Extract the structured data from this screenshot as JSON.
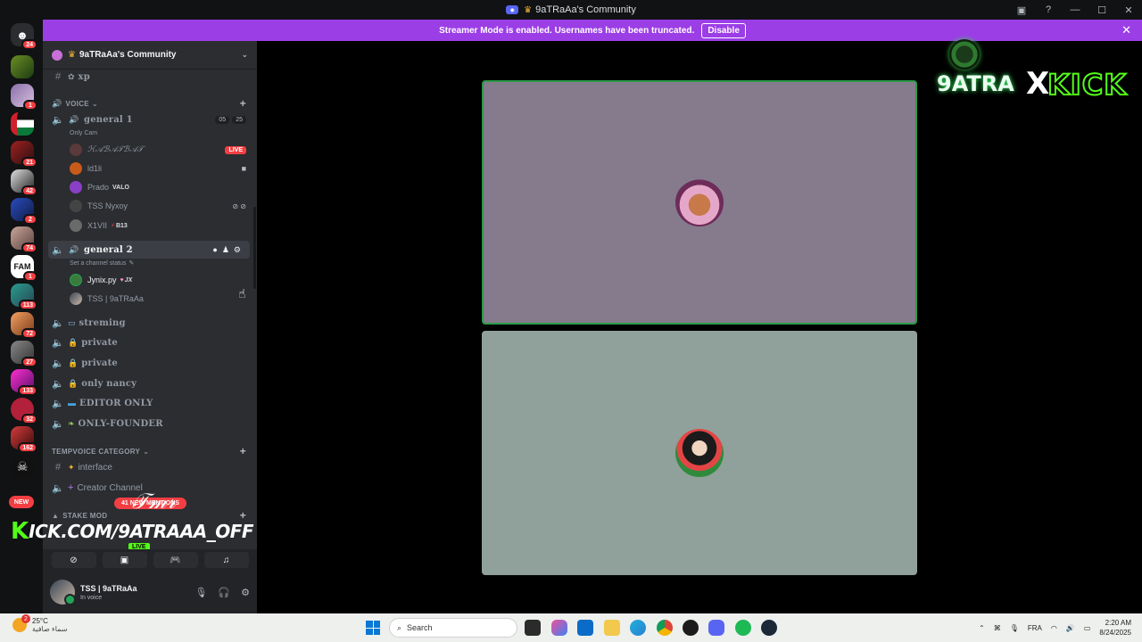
{
  "window": {
    "title": "9aTRaAa's Community"
  },
  "banner": {
    "text": "Streamer Mode is enabled. Usernames have been truncated.",
    "disable_label": "Disable"
  },
  "rail": {
    "home_badge": "24",
    "servers": [
      {
        "badge": ""
      },
      {
        "badge": "1"
      },
      {
        "badge": ""
      },
      {
        "badge": "21"
      },
      {
        "badge": "42"
      },
      {
        "badge": "2"
      },
      {
        "badge": "74"
      },
      {
        "badge": "1"
      },
      {
        "badge": "113"
      },
      {
        "badge": "72"
      },
      {
        "badge": "27"
      },
      {
        "badge": "133"
      },
      {
        "badge": "32"
      },
      {
        "badge": "162"
      },
      {
        "badge": ""
      }
    ],
    "new_label": "NEW"
  },
  "sidebar": {
    "server_name": "9aTRaAa's Community",
    "xp_channel": "xp",
    "voice_category": "VOICE",
    "general1": {
      "name": "general 1",
      "status": "Only Cam",
      "counts": [
        "05",
        "25"
      ],
      "users": [
        {
          "name": "ℋ𝒜ℬ𝒜𝒯ℬ𝒜𝒯",
          "live_label": "LIVE"
        },
        {
          "name": "ld1li"
        },
        {
          "name": "Prado",
          "tag": "VALO"
        },
        {
          "name": "TSS Nyxoy"
        },
        {
          "name": "X1VII",
          "tag": "B13"
        }
      ]
    },
    "general2": {
      "name": "general 2",
      "status": "Set a channel status",
      "users": [
        {
          "name": "Jynix.py",
          "tag": "JX"
        },
        {
          "name": "TSS | 9aTRaAa"
        }
      ]
    },
    "channels": [
      "streming",
      "private",
      "private",
      "only nancy",
      "EDITOR ONLY",
      "ONLY-FOUNDER"
    ],
    "tempvoice_category": "TEMPVOICE CATEGORY",
    "interface_channel": "interface",
    "creator_channel": "Creator Channel",
    "stake_category": "STAKE MOD",
    "mentions": "41 NEW MENTIONS"
  },
  "overlay": {
    "kick_k": "K",
    "kick_rest": "ICK.COM/9ATRAAA_OFF",
    "live": "LIVE"
  },
  "user_panel": {
    "name": "TSS | 9aTRaAa",
    "status": "In voice"
  },
  "brand": {
    "left": "9ATRA",
    "x": "X",
    "right": "KICK"
  },
  "taskbar": {
    "temp": "25°C",
    "weather_desc": "سماء صافية",
    "weather_badge": "2",
    "search_placeholder": "Search",
    "lang": "FRA",
    "time": "2:20 AM",
    "date": "8/24/2025"
  }
}
